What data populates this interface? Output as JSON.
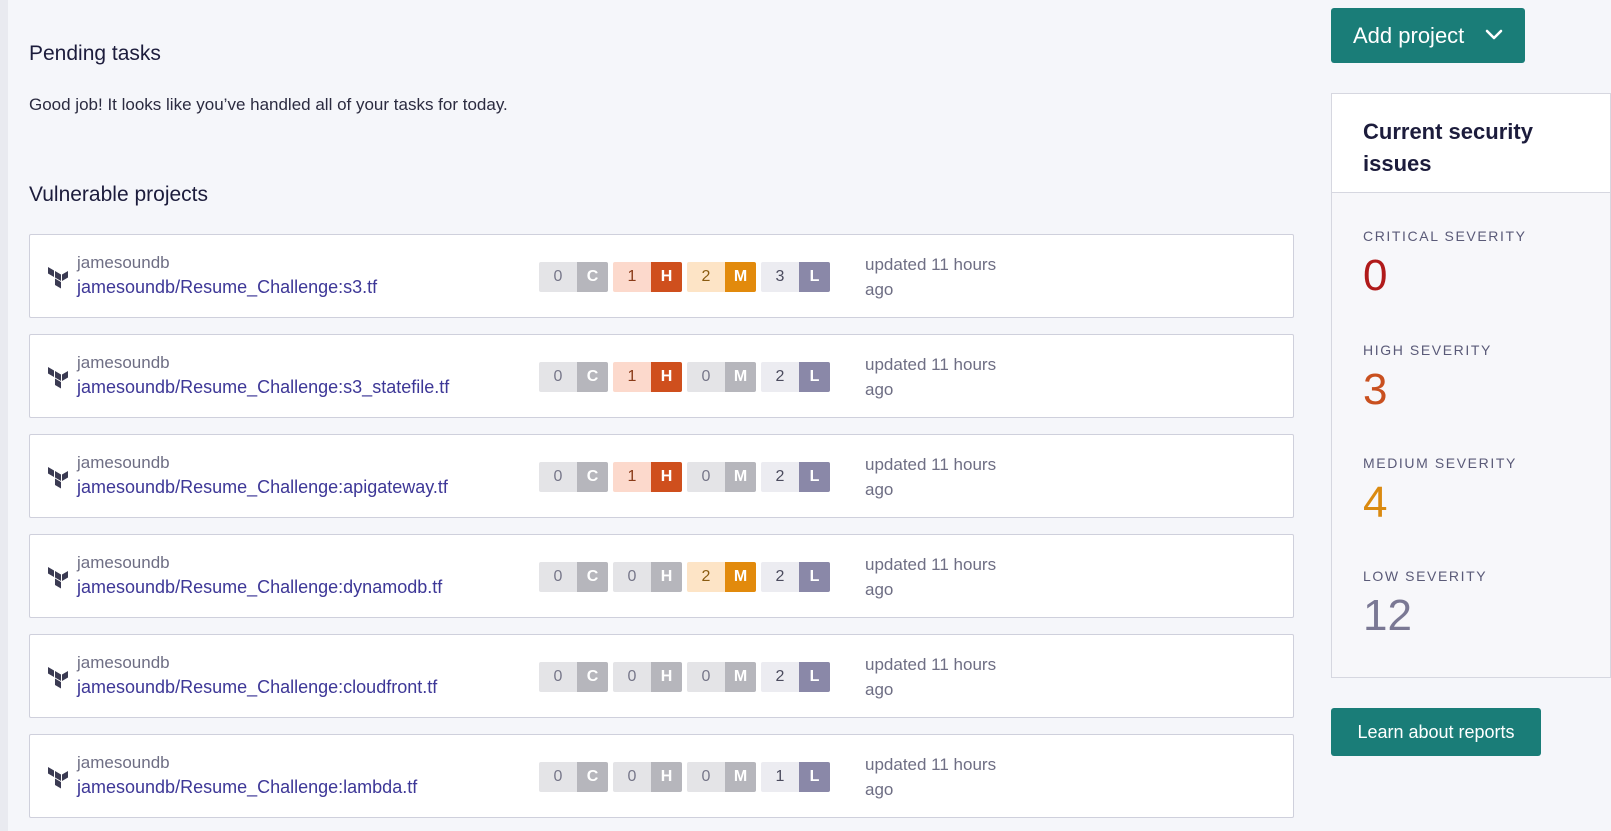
{
  "pending": {
    "title": "Pending tasks",
    "message": "Good job! It looks like you’ve handled all of your tasks for today."
  },
  "vulnerable": {
    "title": "Vulnerable projects",
    "projects": [
      {
        "owner": "jamesoundb",
        "name": "jamesoundb/Resume_Challenge:s3.tf",
        "c": "0",
        "h": "1",
        "m": "2",
        "l": "3",
        "updated": "updated 11 hours ago"
      },
      {
        "owner": "jamesoundb",
        "name": "jamesoundb/Resume_Challenge:s3_statefile.tf",
        "c": "0",
        "h": "1",
        "m": "0",
        "l": "2",
        "updated": "updated 11 hours ago"
      },
      {
        "owner": "jamesoundb",
        "name": "jamesoundb/Resume_Challenge:apigateway.tf",
        "c": "0",
        "h": "1",
        "m": "0",
        "l": "2",
        "updated": "updated 11 hours ago"
      },
      {
        "owner": "jamesoundb",
        "name": "jamesoundb/Resume_Challenge:dynamodb.tf",
        "c": "0",
        "h": "0",
        "m": "2",
        "l": "2",
        "updated": "updated 11 hours ago"
      },
      {
        "owner": "jamesoundb",
        "name": "jamesoundb/Resume_Challenge:cloudfront.tf",
        "c": "0",
        "h": "0",
        "m": "0",
        "l": "2",
        "updated": "updated 11 hours ago"
      },
      {
        "owner": "jamesoundb",
        "name": "jamesoundb/Resume_Challenge:lambda.tf",
        "c": "0",
        "h": "0",
        "m": "0",
        "l": "1",
        "updated": "updated 11 hours ago"
      }
    ],
    "severity_letters": {
      "c": "C",
      "h": "H",
      "m": "M",
      "l": "L"
    }
  },
  "header": {
    "add_project_label": "Add project"
  },
  "security_card": {
    "title": "Current security issues",
    "critical_label": "CRITICAL SEVERITY",
    "critical_value": "0",
    "high_label": "HIGH SEVERITY",
    "high_value": "3",
    "medium_label": "MEDIUM SEVERITY",
    "medium_value": "4",
    "low_label": "LOW SEVERITY",
    "low_value": "12"
  },
  "learn_button_label": "Learn about reports",
  "colors": {
    "accent": "#1a7d78",
    "critical": "#b01a1a",
    "high": "#cf4f1d",
    "medium": "#e28a0c",
    "low": "#8a88a8",
    "link": "#3d3797"
  },
  "icons": {
    "project_icon": "terraform-icon",
    "dropdown_icon": "chevron-down-icon"
  }
}
